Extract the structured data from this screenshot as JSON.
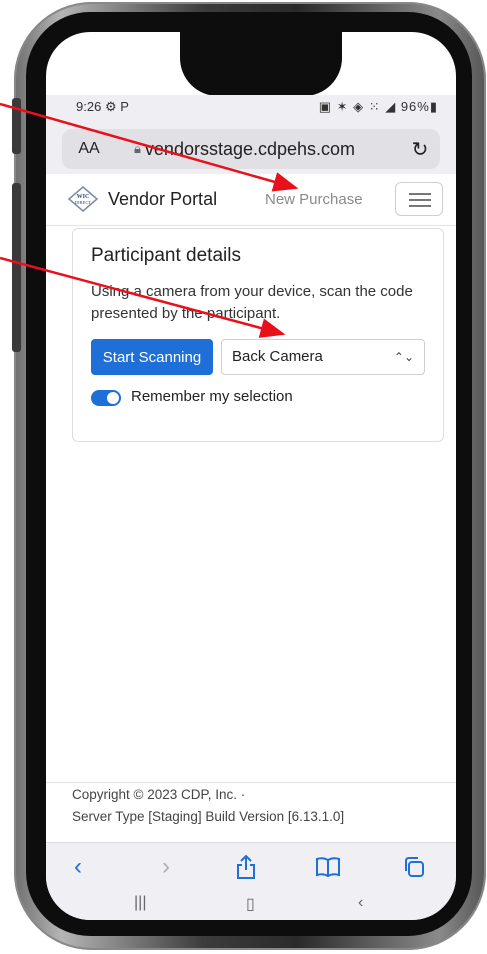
{
  "status_bar": {
    "time": "9:26",
    "left_icons": "⚙ P",
    "right_icons": "▣ ✶ ◈ ⁙ ◢ 96%▮"
  },
  "browser": {
    "text_size_label": "AA",
    "url": "vendorsstage.cdpehs.com"
  },
  "navbar": {
    "brand_name": "Vendor Portal",
    "nav_link": "New Purchase"
  },
  "card": {
    "title": "Participant details",
    "description": "Using a camera from your device, scan the code presented by the participant.",
    "scan_button": "Start Scanning",
    "camera_select_value": "Back Camera",
    "toggle_label": "Remember my selection",
    "toggle_on": true
  },
  "footer": {
    "copyright": "Copyright © 2023 CDP, Inc. ·",
    "build": "Server Type [Staging] Build Version [6.13.1.0]"
  },
  "colors": {
    "primary": "#1f6fd8",
    "annotation_arrow": "#e8101a"
  }
}
